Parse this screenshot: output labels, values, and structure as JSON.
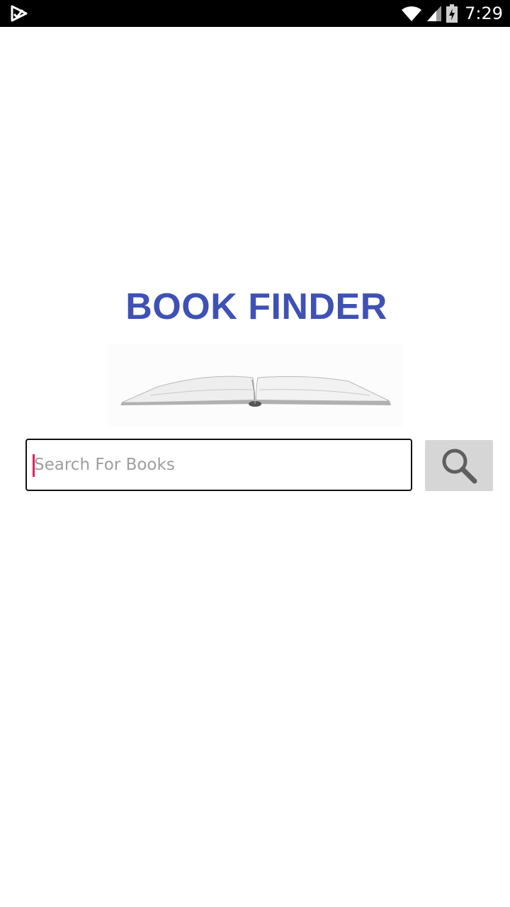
{
  "status_bar": {
    "time": "7:29",
    "icons": [
      "app-notification-icon",
      "wifi-icon",
      "cell-signal-icon",
      "battery-charging-icon"
    ]
  },
  "app": {
    "title": "BOOK FINDER",
    "hero_image": "open-book-image",
    "search": {
      "value": "",
      "placeholder": "Search For Books",
      "button_icon": "search-icon"
    }
  },
  "colors": {
    "title": "#3f51b5",
    "cursor": "#e91e63",
    "button_bg": "#d6d6d6",
    "status_bar_bg": "#000000"
  }
}
